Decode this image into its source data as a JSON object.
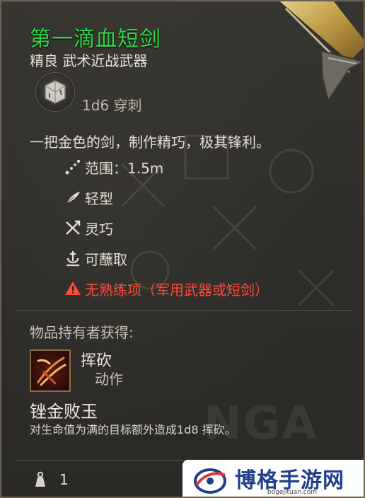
{
  "item": {
    "name": "第一滴血短剑",
    "rarity_type": "精良 武术近战武器",
    "damage": "1d6 穿刺",
    "description": "一把金色的剑，制作精巧，极其锋利。",
    "properties": [
      {
        "icon": "range-icon",
        "label": "范围：1.5m"
      },
      {
        "icon": "feather-icon",
        "label": "轻型"
      },
      {
        "icon": "finesse-icon",
        "label": "灵巧"
      },
      {
        "icon": "dippable-icon",
        "label": "可蘸取"
      },
      {
        "icon": "warning-icon",
        "label": "无熟练项（军用武器或短剑）"
      }
    ],
    "holder_gains_label": "物品持有者获得:",
    "action": {
      "name": "挥砍",
      "type": "动作"
    },
    "skill": {
      "name": "锉金败玉",
      "description": "对生命值为满的目标额外造成1d8 挥砍。"
    },
    "weight": "1"
  },
  "watermark": {
    "nga": "NGA",
    "site_name": "博格手游网",
    "site_url": "bogejituan.com"
  },
  "colors": {
    "name_green": "#34d34a",
    "warning_red": "#ff4a3d",
    "panel_bg": "#2e2d29"
  }
}
